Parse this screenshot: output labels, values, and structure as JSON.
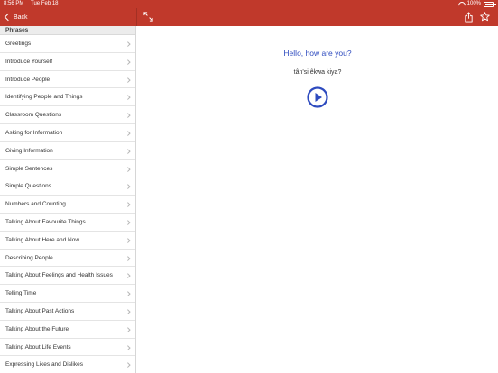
{
  "status_bar": {
    "time": "8:56 PM",
    "date": "Tue Feb 18",
    "battery": "100%"
  },
  "nav": {
    "back_label": "Back"
  },
  "sidebar": {
    "section_title": "Phrases",
    "items": [
      "Greetings",
      "Introduce Yourself",
      "Introduce People",
      "Identifying People and Things",
      "Classroom Questions",
      "Asking for Information",
      "Giving Information",
      "Simple Sentences",
      "Simple Questions",
      "Numbers and Counting",
      "Talking About Favourite Things",
      "Talking About Here and Now",
      "Describing People",
      "Talking About Feelings and Health Issues",
      "Telling Time",
      "Talking About Past Actions",
      "Talking About the Future",
      "Talking About Life Events",
      "Expressing Likes and Dislikes"
    ]
  },
  "detail": {
    "english": "Hello, how are you?",
    "native": "tân'si êkwa kiya?"
  },
  "colors": {
    "brand": "#c0392b",
    "accent": "#2e4bbf"
  },
  "icons": [
    "back-chevron-icon",
    "expand-icon",
    "share-icon",
    "star-icon",
    "play-icon",
    "wifi-icon",
    "battery-icon",
    "chevron-right-icon"
  ]
}
